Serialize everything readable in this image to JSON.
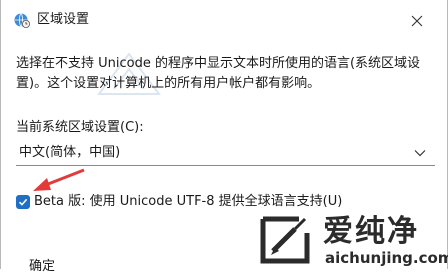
{
  "window": {
    "title": "区域设置",
    "icon": "globe-clock-icon"
  },
  "content": {
    "description": "选择在不支持 Unicode 的程序中显示文本时所使用的语言(系统区域设置)。这个设置对计算机上的所有用户帐户都有影响。",
    "current_locale_label": "当前系统区域设置(C):",
    "current_locale_value": "中文(简体，中国)",
    "beta_checkbox_label": "Beta 版: 使用 Unicode UTF-8 提供全球语言支持(U)",
    "beta_checked": true,
    "cutoff_text": "确定"
  },
  "watermark": {
    "name": "爱纯净",
    "url": "aichunjing.com",
    "colors": {
      "accent": "#2b2b2b"
    }
  },
  "colors": {
    "checkbox": "#1f6fc5",
    "arrow": "#e33a3a"
  }
}
